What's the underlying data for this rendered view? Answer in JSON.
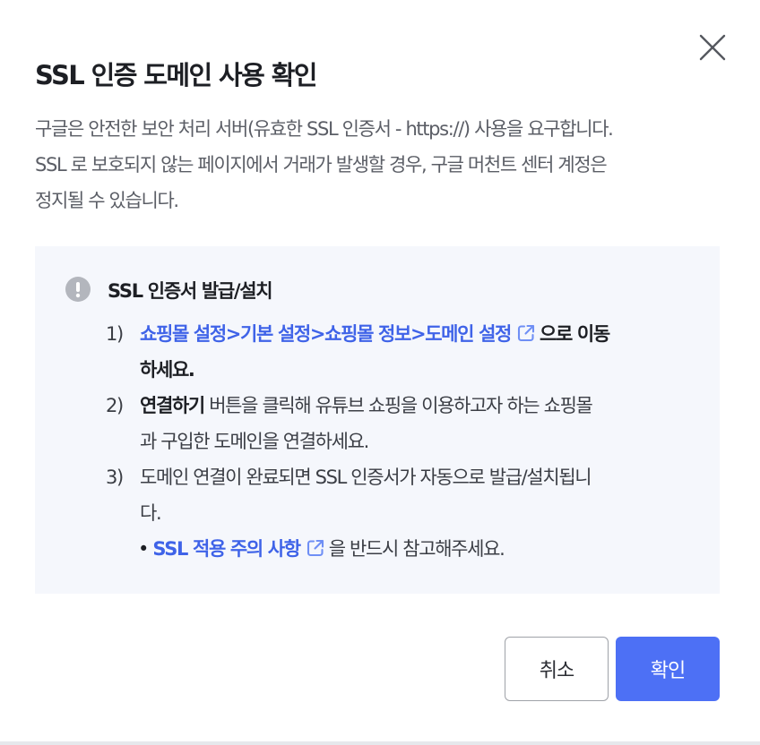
{
  "dialog": {
    "title": "SSL 인증 도메인 사용 확인",
    "close_icon": "close-icon",
    "description_lines": [
      "구글은 안전한 보안 처리 서버(유효한 SSL 인증서 - https://) 사용을 요구합니다.",
      "SSL 로 보호되지 않는 페이지에서 거래가 발생할 경우, 구글 머천트 센터 계정은",
      "정지될 수 있습니다."
    ]
  },
  "notice": {
    "icon": "alert-circle-icon",
    "title": "SSL 인증서 발급/설치",
    "step1": {
      "num": "1)",
      "link": "쇼핑몰 설정>기본 설정>쇼핑몰 정보>도메인 설정",
      "link_icon": "external-link-icon",
      "after": "으로 이동",
      "line2": "하세요."
    },
    "step2": {
      "num": "2)",
      "strong": "연결하기",
      "after": " 버튼을 클릭해 유튜브 쇼핑을 이용하고자 하는 쇼핑몰",
      "line2": "과 구입한 도메인을 연결하세요."
    },
    "step3": {
      "num": "3)",
      "line1": "도메인 연결이 완료되면 SSL 인증서가 자동으로 발급/설치됩니",
      "line2": "다.",
      "bullet": "• ",
      "bullet_link": "SSL 적용 주의 사항",
      "bullet_link_icon": "external-link-icon",
      "bullet_after": "을 반드시 참고해주세요."
    }
  },
  "buttons": {
    "cancel": "취소",
    "confirm": "확인"
  },
  "colors": {
    "accent": "#4d70f5",
    "link": "#3f63e8",
    "notice_bg": "#f5f7fc",
    "text": "#2b2d33",
    "muted": "#5b5e66"
  }
}
